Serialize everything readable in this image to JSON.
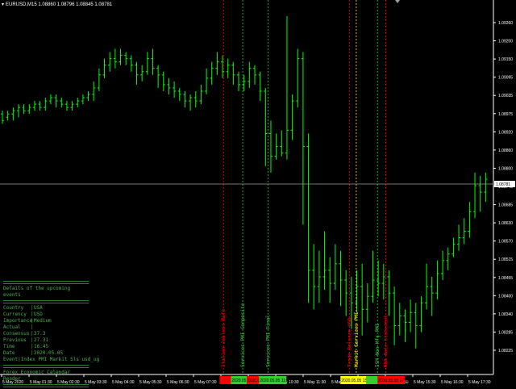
{
  "header": {
    "symbol_line": "EURUSD,M15  1.08860 1.08796 1.08845 1.08781"
  },
  "crosshair_price": "1.08781",
  "colors": {
    "background": "#000000",
    "bar": "#00ff00",
    "grid_text": "#ffffff",
    "event_red": "#ff0000",
    "event_green": "#33cc33",
    "event_yellow": "#ffff00"
  },
  "chart_data": {
    "type": "ohlc",
    "y_ticks": [
      "1.09260",
      "1.09200",
      "1.09150",
      "1.09095",
      "1.09035",
      "1.08975",
      "1.08920",
      "1.08860",
      "1.08800",
      "1.08745",
      "1.08685",
      "1.08630",
      "1.08570",
      "1.08515",
      "1.08455",
      "1.08400",
      "1.08340",
      "1.08285",
      "1.08225"
    ],
    "x_ticks": [
      "5 May 2020",
      "5 May 01:30",
      "5 May 02:30",
      "5 May 03:30",
      "5 May 04:30",
      "5 May 05:30",
      "5 May 06:30",
      "5 May 07:30",
      "5 May 08:30",
      "5 May 09:30",
      "5 May 10:30",
      "5 May 11:30",
      "5 May 12:30",
      "5 May 13:30",
      "5 May 14:30",
      "5 May 15:30",
      "5 May 16:30",
      "5 May 17:30"
    ],
    "ylim": [
      1.0818,
      1.0933
    ],
    "bars": [
      [
        1.0898,
        1.0896,
        1.0899,
        1.0895
      ],
      [
        1.0897,
        1.0898,
        1.0899,
        1.0896
      ],
      [
        1.0898,
        1.0899,
        1.09,
        1.0896
      ],
      [
        1.0899,
        1.09,
        1.0901,
        1.0897
      ],
      [
        1.09,
        1.0899,
        1.0901,
        1.0898
      ],
      [
        1.0899,
        1.09,
        1.0901,
        1.0898
      ],
      [
        1.09,
        1.0901,
        1.0902,
        1.0899
      ],
      [
        1.0901,
        1.09,
        1.0902,
        1.0899
      ],
      [
        1.09,
        1.0902,
        1.0903,
        1.0899
      ],
      [
        1.0902,
        1.0903,
        1.0904,
        1.0901
      ],
      [
        1.0903,
        1.0902,
        1.0904,
        1.09
      ],
      [
        1.0902,
        1.0901,
        1.0903,
        1.09
      ],
      [
        1.0901,
        1.09,
        1.0902,
        1.0899
      ],
      [
        1.09,
        1.0901,
        1.0902,
        1.0899
      ],
      [
        1.0901,
        1.0902,
        1.0903,
        1.09
      ],
      [
        1.0902,
        1.0903,
        1.0904,
        1.0901
      ],
      [
        1.0903,
        1.0904,
        1.0905,
        1.0902
      ],
      [
        1.0904,
        1.0906,
        1.0908,
        1.0902
      ],
      [
        1.0906,
        1.091,
        1.0912,
        1.0905
      ],
      [
        1.091,
        1.0913,
        1.0915,
        1.0909
      ],
      [
        1.0913,
        1.0915,
        1.0917,
        1.0911
      ],
      [
        1.0915,
        1.0914,
        1.0918,
        1.0912
      ],
      [
        1.0914,
        1.0916,
        1.0918,
        1.0913
      ],
      [
        1.0916,
        1.0915,
        1.0917,
        1.0913
      ],
      [
        1.0915,
        1.0913,
        1.0916,
        1.0911
      ],
      [
        1.0913,
        1.091,
        1.0914,
        1.0907
      ],
      [
        1.091,
        1.0911,
        1.0913,
        1.0908
      ],
      [
        1.0911,
        1.0915,
        1.0917,
        1.091
      ],
      [
        1.0915,
        1.0912,
        1.0918,
        1.091
      ],
      [
        1.0912,
        1.091,
        1.0913,
        1.0906
      ],
      [
        1.091,
        1.0907,
        1.0911,
        1.0905
      ],
      [
        1.0907,
        1.0906,
        1.0909,
        1.0904
      ],
      [
        1.0906,
        1.0905,
        1.0908,
        1.0903
      ],
      [
        1.0905,
        1.0904,
        1.0906,
        1.0902
      ],
      [
        1.0904,
        1.0902,
        1.0905,
        1.09
      ],
      [
        1.0902,
        1.0903,
        1.0904,
        1.0899
      ],
      [
        1.0903,
        1.0902,
        1.0905,
        1.09
      ],
      [
        1.0902,
        1.0905,
        1.0907,
        1.0901
      ],
      [
        1.0905,
        1.0909,
        1.0912,
        1.0904
      ],
      [
        1.0909,
        1.0912,
        1.0914,
        1.0907
      ],
      [
        1.0912,
        1.0914,
        1.0917,
        1.091
      ],
      [
        1.0914,
        1.0911,
        1.0916,
        1.0909
      ],
      [
        1.0911,
        1.0913,
        1.0915,
        1.0909
      ],
      [
        1.0913,
        1.091,
        1.0914,
        1.0907
      ],
      [
        1.091,
        1.0907,
        1.0911,
        1.0905
      ],
      [
        1.0907,
        1.0908,
        1.091,
        1.0905
      ],
      [
        1.0908,
        1.0912,
        1.0914,
        1.0906
      ],
      [
        1.0912,
        1.091,
        1.0913,
        1.0907
      ],
      [
        1.091,
        1.0905,
        1.0911,
        1.0902
      ],
      [
        1.0905,
        1.0892,
        1.0906,
        1.0882
      ],
      [
        1.0892,
        1.0885,
        1.0896,
        1.088
      ],
      [
        1.0885,
        1.0888,
        1.0892,
        1.0884
      ],
      [
        1.0888,
        1.0886,
        1.0893,
        1.0885
      ],
      [
        1.0886,
        1.0893,
        1.0928,
        1.0884
      ],
      [
        1.0893,
        1.0902,
        1.0904,
        1.089
      ],
      [
        1.0902,
        1.0915,
        1.0918,
        1.09
      ],
      [
        1.0915,
        1.0888,
        1.0917,
        1.0864
      ],
      [
        1.0888,
        1.085,
        1.0892,
        1.084
      ],
      [
        1.085,
        1.0845,
        1.0858,
        1.0838
      ],
      [
        1.0845,
        1.0848,
        1.0856,
        1.084
      ],
      [
        1.0848,
        1.085,
        1.0862,
        1.0844
      ],
      [
        1.085,
        1.0846,
        1.0854,
        1.084
      ],
      [
        1.0846,
        1.0852,
        1.0858,
        1.0844
      ],
      [
        1.0852,
        1.0847,
        1.0856,
        1.0839
      ],
      [
        1.0847,
        1.0843,
        1.085,
        1.0836
      ],
      [
        1.0843,
        1.084,
        1.0848,
        1.0832
      ],
      [
        1.084,
        1.0845,
        1.085,
        1.0837
      ],
      [
        1.0845,
        1.0838,
        1.0852,
        1.083
      ],
      [
        1.0838,
        1.0842,
        1.0846,
        1.0834
      ],
      [
        1.0842,
        1.0847,
        1.0856,
        1.084
      ],
      [
        1.0847,
        1.0846,
        1.0853,
        1.0842
      ],
      [
        1.0846,
        1.0848,
        1.0852,
        1.0841
      ],
      [
        1.0848,
        1.0843,
        1.085,
        1.0836
      ],
      [
        1.0843,
        1.0833,
        1.0845,
        1.0827
      ],
      [
        1.0833,
        1.0836,
        1.084,
        1.083
      ],
      [
        1.0836,
        1.0834,
        1.0838,
        1.0828
      ],
      [
        1.0834,
        1.0837,
        1.0841,
        1.0831
      ],
      [
        1.0837,
        1.0833,
        1.084,
        1.0826
      ],
      [
        1.0833,
        1.084,
        1.0842,
        1.0831
      ],
      [
        1.084,
        1.0845,
        1.0852,
        1.0838
      ],
      [
        1.0845,
        1.0843,
        1.0848,
        1.0836
      ],
      [
        1.0843,
        1.0849,
        1.0853,
        1.0841
      ],
      [
        1.0849,
        1.0853,
        1.0856,
        1.0847
      ],
      [
        1.0853,
        1.0855,
        1.0857,
        1.085
      ],
      [
        1.0855,
        1.0858,
        1.086,
        1.0854
      ],
      [
        1.0858,
        1.086,
        1.0864,
        1.0856
      ],
      [
        1.086,
        1.0862,
        1.0866,
        1.0858
      ],
      [
        1.0862,
        1.0868,
        1.0871,
        1.086
      ],
      [
        1.0868,
        1.0876,
        1.088,
        1.0866
      ],
      [
        1.0876,
        1.0874,
        1.0879,
        1.0868
      ],
      [
        1.0874,
        1.0878,
        1.088,
        1.0871
      ]
    ],
    "events": [
      {
        "x": 0.453,
        "color": "red",
        "text": "Italian Jobless Rate"
      },
      {
        "x": 0.492,
        "color": "green",
        "text": "Services PMI Composite"
      },
      {
        "x": 0.543,
        "color": "green",
        "text": "Services PMI Final"
      },
      {
        "x": 0.708,
        "color": "red",
        "text": "Trade Balance USD"
      },
      {
        "x": 0.722,
        "color": "yellow",
        "text": "Markit Services PMI"
      },
      {
        "x": 0.765,
        "color": "green",
        "text": "ISM Non-Mfg PMI"
      },
      {
        "x": 0.782,
        "color": "red",
        "text": "RBA Rate Statement"
      }
    ],
    "bottom_boxes": [
      {
        "label": "",
        "color": "red",
        "x": 0.445
      },
      {
        "label": "2020.05.05 09:30",
        "color": "green",
        "x": 0.468
      },
      {
        "label": "2020.05.05 10:00",
        "color": "red",
        "x": 0.5
      },
      {
        "label": "2020.05.05 11:00",
        "color": "green",
        "x": 0.525
      },
      {
        "label": "2020.05.05 15:30",
        "color": "yellow",
        "x": 0.69
      },
      {
        "label": "",
        "color": "green",
        "x": 0.742
      },
      {
        "label": "2020.05.05 17:00",
        "color": "red",
        "x": 0.765
      }
    ]
  },
  "details": {
    "title": "Details of the upcoming events",
    "rows": [
      {
        "k": "Country",
        "v": "USA"
      },
      {
        "k": "Currency",
        "v": "USD"
      },
      {
        "k": "Importance",
        "v": "Medium"
      },
      {
        "k": "Actual",
        "v": ""
      },
      {
        "k": "Consensus",
        "v": "37.3"
      },
      {
        "k": "Previous",
        "v": "27.31"
      },
      {
        "k": "Time",
        "v": "16:45"
      },
      {
        "k": "Date",
        "v": "2020.05.05"
      },
      {
        "k": "Event",
        "v": "Index PMI Markit Sls usd_ug"
      }
    ],
    "footer": "Forex Economic Calendar Reader"
  }
}
